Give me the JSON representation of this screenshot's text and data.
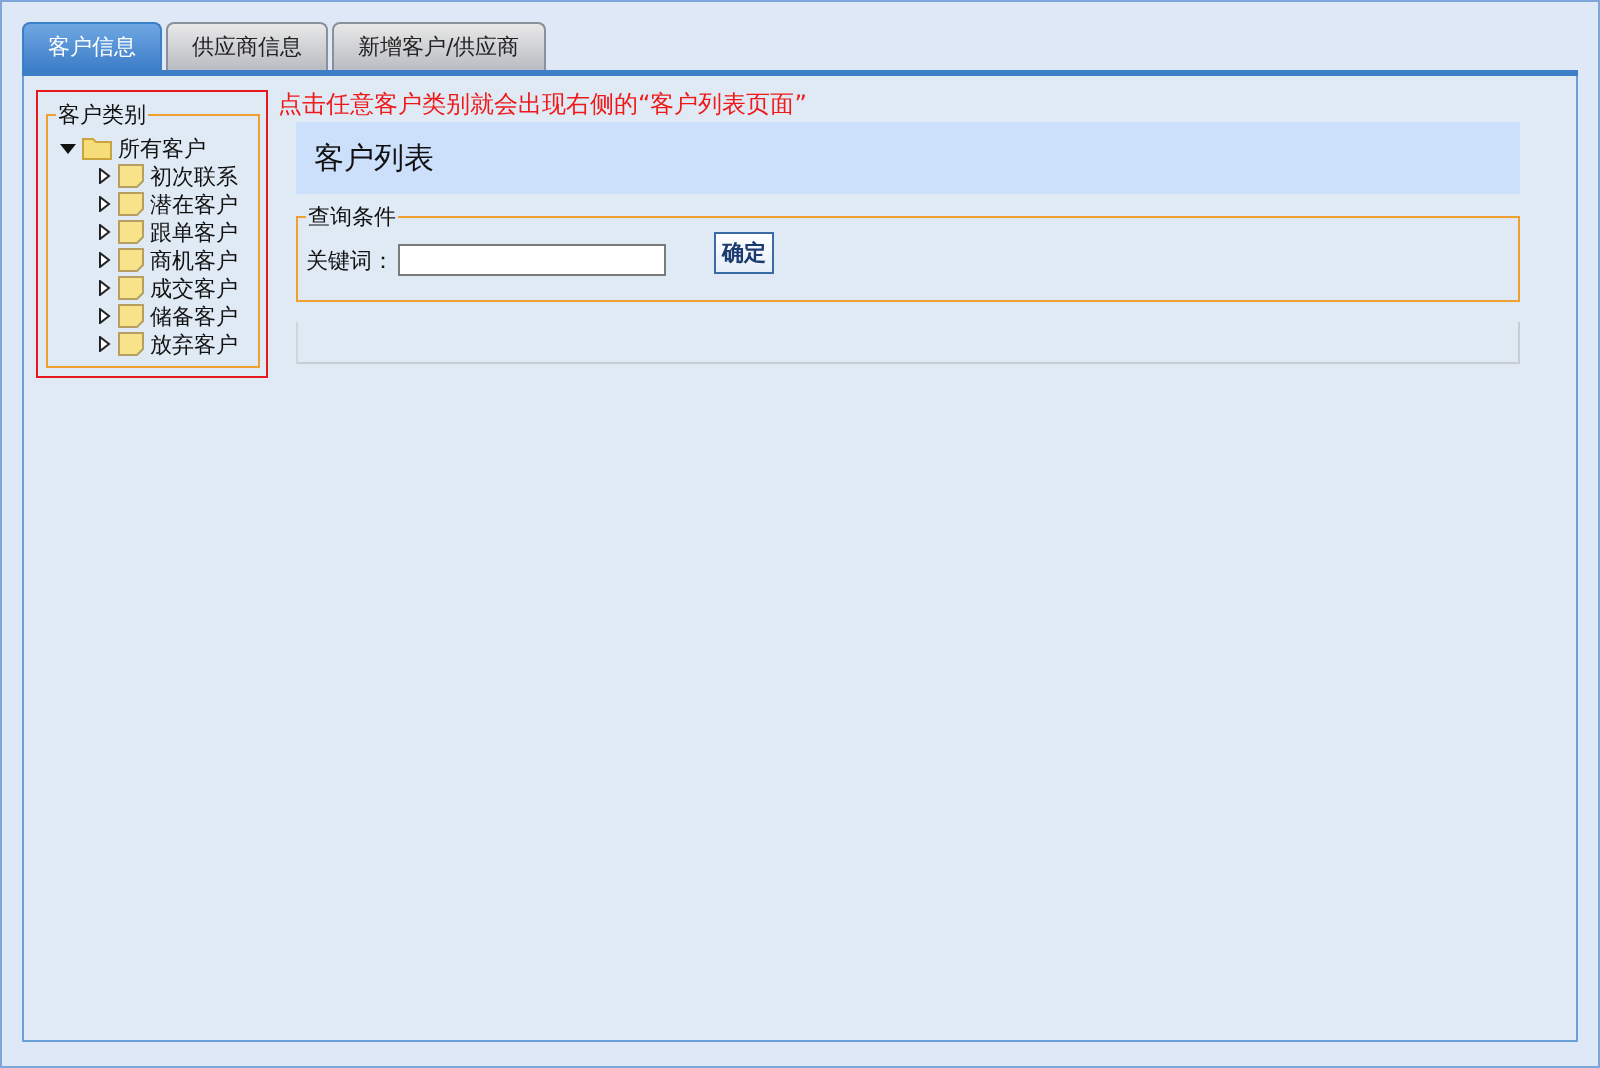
{
  "tabs": [
    {
      "label": "客户信息",
      "selected": true
    },
    {
      "label": "供应商信息",
      "selected": false
    },
    {
      "label": "新增客户/供应商",
      "selected": false
    }
  ],
  "category_panel": {
    "legend": "客户类别",
    "tree": {
      "label": "所有客户",
      "expanded": true,
      "children": [
        {
          "label": "初次联系",
          "expanded": false
        },
        {
          "label": "潜在客户",
          "expanded": false
        },
        {
          "label": "跟单客户",
          "expanded": false
        },
        {
          "label": "商机客户",
          "expanded": false
        },
        {
          "label": "成交客户",
          "expanded": false
        },
        {
          "label": "储备客户",
          "expanded": false
        },
        {
          "label": "放弃客户",
          "expanded": false
        }
      ]
    }
  },
  "annotation": "点击任意客户类别就会出现右侧的“客户列表页面”",
  "customer_list": {
    "title": "客户列表",
    "query": {
      "legend": "查询条件",
      "keyword_label": "关键词：",
      "button": "确定"
    }
  }
}
